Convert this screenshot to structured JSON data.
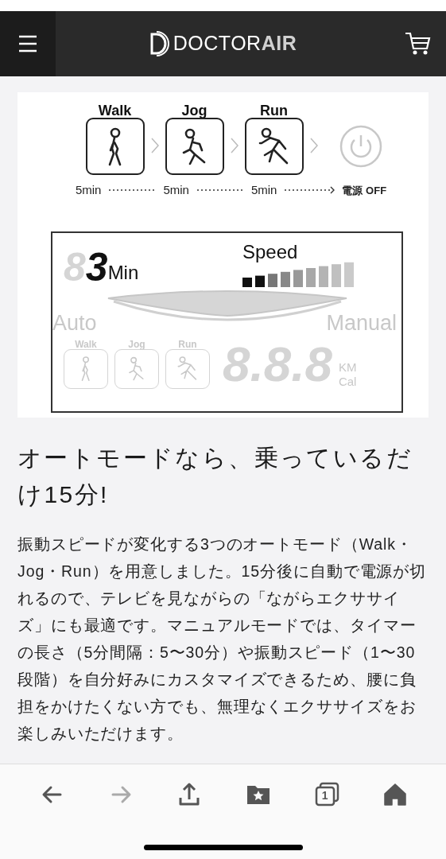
{
  "header": {
    "logo": {
      "text": "DOCTOR",
      "accent": "AIR"
    }
  },
  "figure": {
    "modes": [
      {
        "kind": "walk",
        "label": "Walk",
        "duration": "5min"
      },
      {
        "kind": "jog",
        "label": "Jog",
        "duration": "5min"
      },
      {
        "kind": "run",
        "label": "Run",
        "duration": "5min"
      }
    ],
    "end_label": "電源 OFF",
    "display": {
      "timer_ghost": "8",
      "timer_value": "3",
      "timer_unit": "Min",
      "speed_label": "Speed",
      "speed": {
        "level": 0.22
      },
      "auto_label": "Auto",
      "manual_label": "Manual",
      "modes": [
        {
          "kind": "walk",
          "label": "Walk"
        },
        {
          "kind": "jog",
          "label": "Jog"
        },
        {
          "kind": "run",
          "label": "Run"
        }
      ],
      "readout": "8.8.8",
      "units": [
        "KM",
        "Cal"
      ]
    }
  },
  "heading": "オートモードなら、乗っているだけ15分!",
  "paragraph": "振動スピードが変化する3つのオートモード（Walk・Jog・Run）を用意しました。15分後に自動で電源が切れるので、テレビを見ながらの「ながらエクササイズ」にも最適です。マニュアルモードでは、タイマーの長さ（5分間隔：5〜30分）や振動スピード（1〜30段階）を自分好みにカスタマイズできるため、腰に負担をかけたくない方でも、無理なくエクササイズをお楽しみいただけます。",
  "toolbar": [
    {
      "kind": "back",
      "disabled": false
    },
    {
      "kind": "forward",
      "disabled": true
    },
    {
      "kind": "share",
      "disabled": false
    },
    {
      "kind": "bookmarks",
      "disabled": false
    },
    {
      "kind": "tabs",
      "count": "1",
      "disabled": false
    },
    {
      "kind": "home",
      "disabled": false
    }
  ]
}
